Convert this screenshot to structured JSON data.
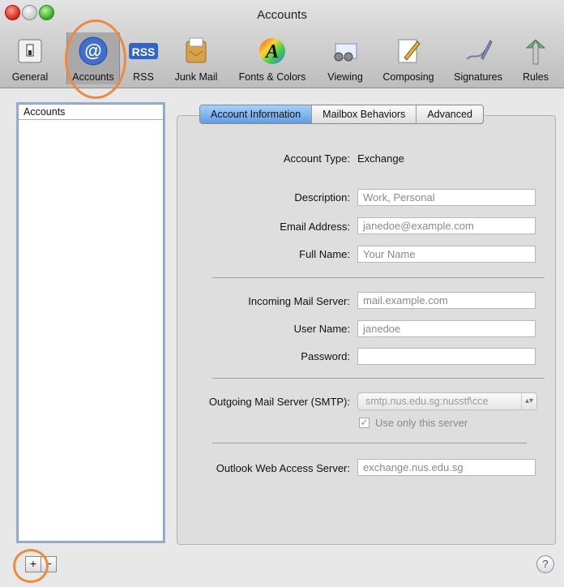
{
  "window": {
    "title": "Accounts"
  },
  "toolbar": [
    {
      "label": "General",
      "icon": "general-switch-icon"
    },
    {
      "label": "Accounts",
      "icon": "at-sign-icon",
      "selected": true
    },
    {
      "label": "RSS",
      "icon": "rss-icon"
    },
    {
      "label": "Junk Mail",
      "icon": "junk-mail-icon"
    },
    {
      "label": "Fonts & Colors",
      "icon": "fonts-colors-icon"
    },
    {
      "label": "Viewing",
      "icon": "viewing-icon"
    },
    {
      "label": "Composing",
      "icon": "composing-icon"
    },
    {
      "label": "Signatures",
      "icon": "signatures-icon"
    },
    {
      "label": "Rules",
      "icon": "rules-icon"
    }
  ],
  "sidebar": {
    "header": "Accounts",
    "add_label": "+",
    "remove_label": "−"
  },
  "tabs": [
    "Account Information",
    "Mailbox Behaviors",
    "Advanced"
  ],
  "form": {
    "account_type_label": "Account Type:",
    "account_type_value": "Exchange",
    "description_label": "Description:",
    "description_value": "Work, Personal",
    "email_label": "Email Address:",
    "email_value": "janedoe@example.com",
    "fullname_label": "Full Name:",
    "fullname_value": "Your Name",
    "incoming_label": "Incoming Mail Server:",
    "incoming_value": "mail.example.com",
    "username_label": "User Name:",
    "username_value": "janedoe",
    "password_label": "Password:",
    "password_value": "",
    "smtp_label": "Outgoing Mail Server (SMTP):",
    "smtp_value": "smtp.nus.edu.sg:nusstf\\cce",
    "use_only_label": "Use only this server",
    "use_only_checked": true,
    "owa_label": "Outlook Web Access Server:",
    "owa_value": "exchange.nus.edu.sg"
  },
  "help_label": "?"
}
